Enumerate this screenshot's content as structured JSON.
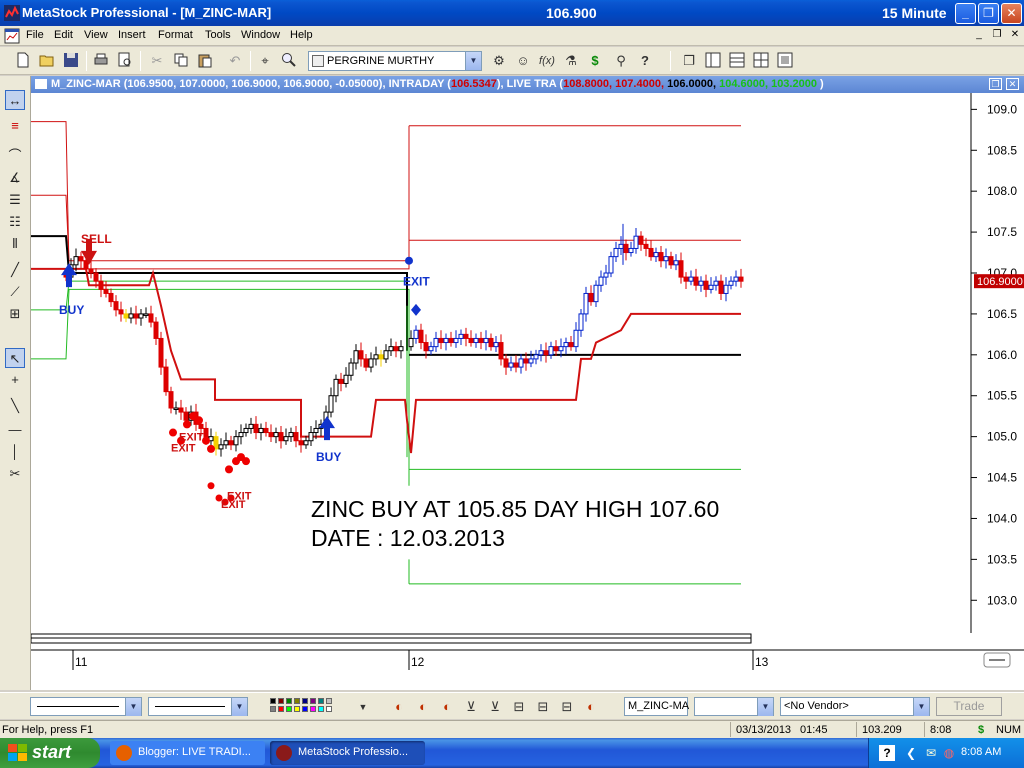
{
  "window": {
    "title": "MetaStock Professional - [M_ZINC-MAR]",
    "price": "106.900",
    "period": "15 Minute",
    "minimize_glyph": "_",
    "restore_glyph": "❐",
    "close_glyph": "✕"
  },
  "menu": [
    "File",
    "Edit",
    "View",
    "Insert",
    "Format",
    "Tools",
    "Window",
    "Help"
  ],
  "toolbar": {
    "data_vendor": "PERGRINE MURTHY",
    "dollar_glyph": "$",
    "icons": [
      "new-file-icon",
      "open-folder-icon",
      "save-icon",
      "print-icon",
      "print-preview-icon",
      "undo-icon",
      "cut-icon",
      "copy-icon",
      "paste-icon",
      "crosshair-icon",
      "zoom-icon"
    ]
  },
  "chart_header": {
    "symbol": "M_ZINC-MAR",
    "ohlc": "(106.9500, 107.0000, 106.9000, 106.9000, -0.05000)",
    "intraday_label": "INTRADAY",
    "intraday_value": "106.5347",
    "live_label": "LIVE TRA",
    "live_red": "108.8000, 107.4000,",
    "live_black": "106.0000,",
    "live_green": "104.6000, 103.2000"
  },
  "chart_data": {
    "type": "candlestick",
    "y_ticks": [
      "109.0",
      "108.5",
      "108.0",
      "107.5",
      "107.0",
      "106.5",
      "106.0",
      "105.5",
      "105.0",
      "104.5",
      "104.0",
      "103.5",
      "103.0"
    ],
    "ylim": [
      102.6,
      109.2
    ],
    "x_ticks": [
      "11",
      "12",
      "13"
    ],
    "last_price_label": "106.9000",
    "signals": [
      {
        "label": "SELL",
        "type": "sell"
      },
      {
        "label": "BUY",
        "type": "buy"
      },
      {
        "label": "EXIT",
        "type": "exit"
      },
      {
        "label": "EXIT",
        "type": "exit"
      },
      {
        "label": "EXIT",
        "type": "exit"
      },
      {
        "label": "EXIT",
        "type": "exit"
      },
      {
        "label": "BUY",
        "type": "buy"
      },
      {
        "label": "EXIT",
        "type": "exit"
      }
    ],
    "levels_day12": {
      "resistance_2": 108.8,
      "resistance_1": 107.4,
      "pivot": 106.0,
      "support_1": 104.6,
      "support_2": 103.2
    }
  },
  "annotation": {
    "line1": "ZINC BUY AT 105.85 DAY HIGH 107.60",
    "line2": "DATE : 12.03.2013"
  },
  "format_bar": {
    "symbol_field": "M_ZINC-MA",
    "vendor_select": "<No Vendor>",
    "trade_button": "Trade"
  },
  "status": {
    "help": "For Help, press F1",
    "date": "03/13/2013",
    "time": "01:45",
    "value": "103.209",
    "clock": "8:08",
    "dollar": "$",
    "num": "NUM"
  },
  "taskbar": {
    "start": "start",
    "tasks": [
      "Blogger: LIVE TRADI...",
      "MetaStock Professio..."
    ],
    "clock": "8:08 AM"
  },
  "colors": {
    "titlebar": "#0049c4",
    "band_red": "#d01010",
    "band_green": "#22bb22",
    "pivot": "#000000",
    "buy_signal": "#1133cc",
    "sell_signal": "#cc1111",
    "candle_down": "#dd0000",
    "candle_up": "#0022cc",
    "exit_dot": "#ee0000"
  }
}
